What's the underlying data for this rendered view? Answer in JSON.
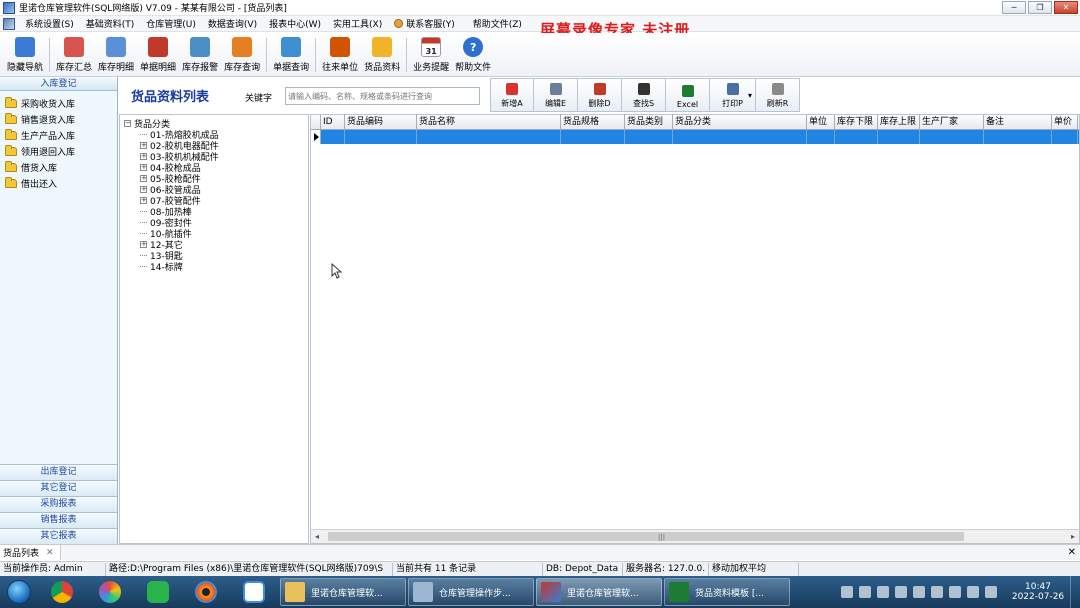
{
  "window": {
    "title": "里诺仓库管理软件(SQL网络版) V7.09 - 某某有限公司 - [货品列表]",
    "controls": [
      "─",
      "❐",
      "✕"
    ]
  },
  "menu": {
    "items": [
      "系统设置(S)",
      "基础资料(T)",
      "仓库管理(U)",
      "数据查询(V)",
      "报表中心(W)",
      "实用工具(X)",
      "联系客服(Y)",
      "帮助文件(Z)"
    ],
    "mdi_controls": [
      "─",
      "❐",
      "✕"
    ]
  },
  "watermark": "屏幕录像专家  未注册",
  "toolbar": {
    "items": [
      {
        "label": "隐藏导航",
        "icon": "monitor-icon",
        "color": "#3b7bd6"
      },
      {
        "label": "库存汇总",
        "icon": "inventory-summary-icon",
        "color": "#d9534f"
      },
      {
        "label": "库存明细",
        "icon": "inventory-detail-icon",
        "color": "#5b8fd8"
      },
      {
        "label": "单据明细",
        "icon": "document-detail-icon",
        "color": "#c0392b"
      },
      {
        "label": "库存报警",
        "icon": "alarm-icon",
        "color": "#4a90c8"
      },
      {
        "label": "库存查询",
        "icon": "query-icon",
        "color": "#e67e22"
      },
      {
        "label": "单据查询",
        "icon": "document-search-icon",
        "color": "#3d8fd1"
      },
      {
        "label": "往来单位",
        "icon": "partners-icon",
        "color": "#d35400"
      },
      {
        "label": "货品资料",
        "icon": "goods-icon",
        "color": "#f0b429"
      },
      {
        "label": "业务提醒",
        "icon": "calendar-icon",
        "color": "#c0392b",
        "text": "31"
      },
      {
        "label": "帮助文件",
        "icon": "help-icon",
        "color": "#2f6fd0",
        "text": "?"
      }
    ]
  },
  "sidebar": {
    "header": "入库登记",
    "items": [
      "采购收货入库",
      "销售退货入库",
      "生产产品入库",
      "领用退回入库",
      "借货入库",
      "借出还入"
    ],
    "bottom_nav": [
      "出库登记",
      "其它登记",
      "采购报表",
      "销售报表",
      "其它报表"
    ]
  },
  "main": {
    "title": "货品资料列表",
    "keyword_label": "关键字",
    "search_placeholder": "请输入编码、名称、规格或条码进行查询",
    "actions": [
      {
        "label": "新增A",
        "icon": "add-icon",
        "color": "#d9342b"
      },
      {
        "label": "编辑E",
        "icon": "edit-icon",
        "color": "#6b7f9a"
      },
      {
        "label": "删除D",
        "icon": "delete-icon",
        "color": "#c0392b"
      },
      {
        "label": "查找S",
        "icon": "binoculars-icon",
        "color": "#333333"
      },
      {
        "label": "Excel",
        "icon": "excel-icon",
        "color": "#1e7b34"
      },
      {
        "label": "打印P",
        "icon": "print-icon",
        "color": "#4a6fa5"
      },
      {
        "label": "刷新R",
        "icon": "refresh-icon",
        "color": "#8a8a8a"
      }
    ]
  },
  "tree": {
    "root": "货品分类",
    "nodes": [
      {
        "label": "01-热熔胶机成品",
        "expandable": false
      },
      {
        "label": "02-胶机电器配件",
        "expandable": true
      },
      {
        "label": "03-胶机机械配件",
        "expandable": true
      },
      {
        "label": "04-胶枪成品",
        "expandable": true
      },
      {
        "label": "05-胶枪配件",
        "expandable": true
      },
      {
        "label": "06-胶管成品",
        "expandable": true
      },
      {
        "label": "07-胶管配件",
        "expandable": true
      },
      {
        "label": "08-加热棒",
        "expandable": false
      },
      {
        "label": "09-密封件",
        "expandable": false
      },
      {
        "label": "10-航插件",
        "expandable": false
      },
      {
        "label": "12-其它",
        "expandable": true
      },
      {
        "label": "13-钥匙",
        "expandable": false
      },
      {
        "label": "14-标牌",
        "expandable": false
      }
    ]
  },
  "grid": {
    "columns": [
      "ID",
      "货品编码",
      "货品名称",
      "货品规格",
      "货品类别",
      "货品分类",
      "单位",
      "库存下限",
      "库存上限",
      "生产厂家",
      "备注",
      "单价"
    ]
  },
  "tabs": [
    {
      "label": "货品列表",
      "close": "✕"
    }
  ],
  "tabs_close_all": "✕",
  "status": {
    "operator": "当前操作员: Admin",
    "path": "路径:D:\\Program Files (x86)\\里诺仓库管理软件(SQL网络版)709\\S",
    "records": "当前共有 11 条记录",
    "db": "DB: Depot_Data",
    "server": "服务器名: 127.0.0.",
    "method": "移动加权平均"
  },
  "taskbar": {
    "tasks": [
      {
        "label": "里诺仓库管理软...",
        "icon": "folder-icon",
        "color": "#e8c15a"
      },
      {
        "label": "仓库管理操作步...",
        "icon": "notepad-icon",
        "color": "#9bb7d4"
      },
      {
        "label": "里诺仓库管理软...",
        "icon": "app-window-icon",
        "color": "#c0392b"
      },
      {
        "label": "货品资料模板 [...",
        "icon": "excel-icon",
        "color": "#1e7b34"
      }
    ],
    "clock_time": "10:47",
    "clock_date": "2022-07-26"
  }
}
